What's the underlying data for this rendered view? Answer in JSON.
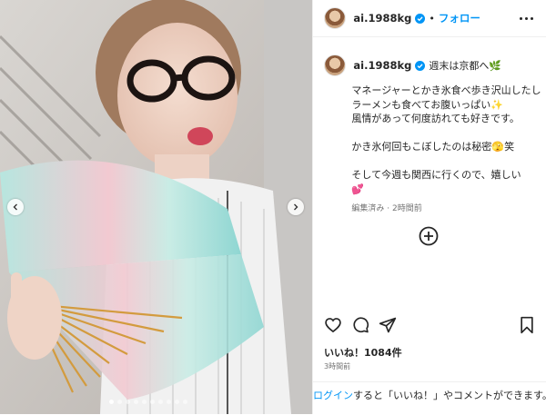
{
  "header": {
    "username": "ai.1988kg",
    "separator": "•",
    "follow_label": "フォロー"
  },
  "caption": {
    "username": "ai.1988kg",
    "title": "週末は京都へ🌿",
    "body": "マネージャーとかき氷食べ歩き沢山したし\nラーメンも食べてお腹いっぱい✨\n風情があって何度訪れても好きです。\n\nかき氷何回もこぼしたのは秘密🫣笑\n\nそして今週も関西に行くので、嬉しい\n💕",
    "meta": "編集済み · 2時間前"
  },
  "stats": {
    "likes": "いいね！1084件",
    "posted": "3時間前"
  },
  "login": {
    "link": "ログイン",
    "text": "すると「いいね！」やコメントができます。"
  },
  "carousel": {
    "dot_count": 10,
    "active_index": 0
  },
  "icons": {
    "verified": "verified-badge-icon",
    "more": "more-options-icon",
    "add": "add-circle-icon",
    "like": "heart-icon",
    "comment": "comment-icon",
    "share": "share-icon",
    "save": "bookmark-icon",
    "prev": "chevron-left-icon",
    "next": "chevron-right-icon"
  },
  "colors": {
    "accent": "#0095f6",
    "text": "#262626",
    "muted": "#737373",
    "border": "#efefef"
  }
}
